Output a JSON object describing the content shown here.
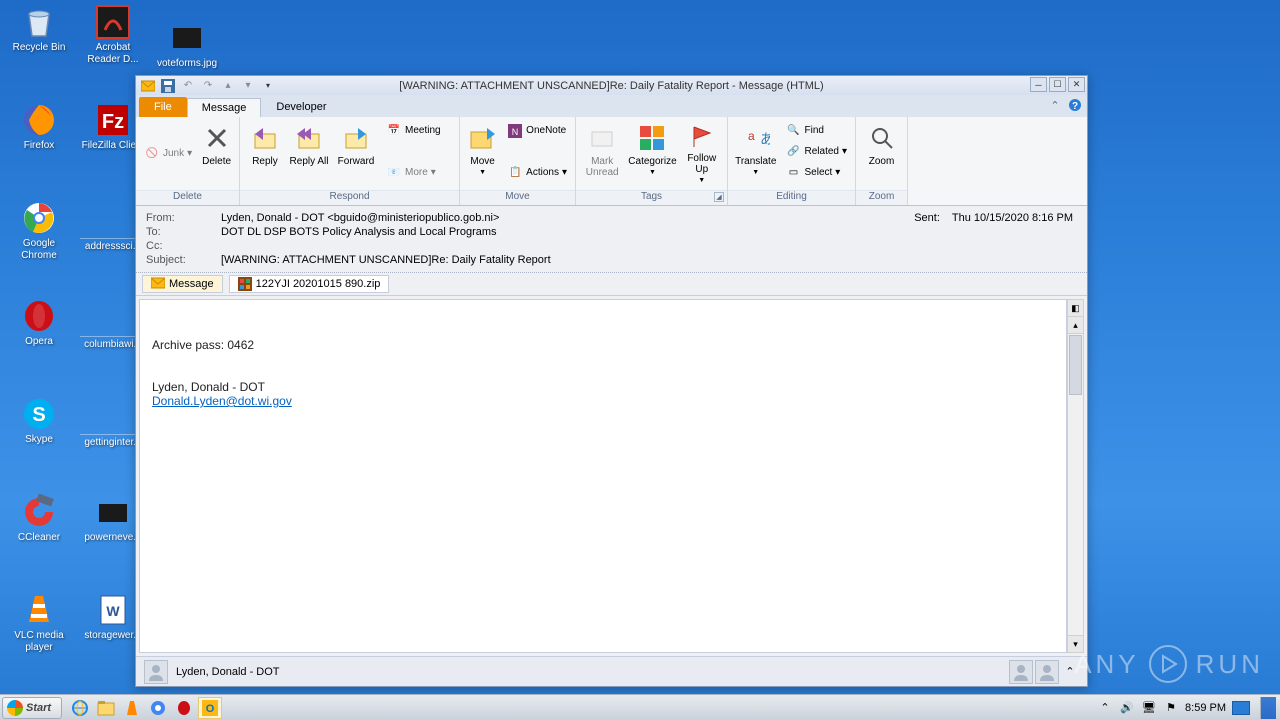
{
  "desktop": {
    "icons": [
      {
        "label": "Recycle Bin"
      },
      {
        "label": "Acrobat Reader D..."
      },
      {
        "label": "voteforms.jpg"
      },
      {
        "label": "Firefox"
      },
      {
        "label": "FileZilla Clie..."
      },
      {
        "label": "Google Chrome"
      },
      {
        "label": "addresssci..."
      },
      {
        "label": "Opera"
      },
      {
        "label": "columbiawi..."
      },
      {
        "label": "Skype"
      },
      {
        "label": "gettinginter..."
      },
      {
        "label": "CCleaner"
      },
      {
        "label": "powerneve..."
      },
      {
        "label": "VLC media player"
      },
      {
        "label": "storagewer..."
      }
    ]
  },
  "window": {
    "title": "[WARNING: ATTACHMENT UNSCANNED]Re: Daily Fatality Report  -  Message (HTML)"
  },
  "tabs": {
    "file": "File",
    "message": "Message",
    "developer": "Developer"
  },
  "ribbon": {
    "junk": "Junk",
    "delete": "Delete",
    "delete_group": "Delete",
    "reply": "Reply",
    "reply_all": "Reply All",
    "forward": "Forward",
    "meeting": "Meeting",
    "more": "More",
    "respond_group": "Respond",
    "move": "Move",
    "onenote": "OneNote",
    "actions": "Actions",
    "move_group": "Move",
    "mark_unread": "Mark Unread",
    "categorize": "Categorize",
    "follow_up": "Follow Up",
    "tags_group": "Tags",
    "translate": "Translate",
    "find": "Find",
    "related": "Related",
    "select": "Select",
    "editing_group": "Editing",
    "zoom": "Zoom",
    "zoom_group": "Zoom"
  },
  "header": {
    "from_label": "From:",
    "from_value": "Lyden, Donald - DOT <bguido@ministeriopublico.gob.ni>",
    "to_label": "To:",
    "to_value": "DOT DL DSP BOTS Policy Analysis and Local Programs",
    "cc_label": "Cc:",
    "cc_value": "",
    "subject_label": "Subject:",
    "subject_value": "[WARNING: ATTACHMENT UNSCANNED]Re: Daily Fatality Report",
    "sent_label": "Sent:",
    "sent_value": "Thu 10/15/2020 8:16 PM"
  },
  "attachments": {
    "message_tab": "Message",
    "file_name": "122YJI 20201015 890.zip"
  },
  "body": {
    "line1": "Archive pass: 0462",
    "signature_name": "Lyden, Donald - DOT",
    "signature_email": "Donald.Lyden@dot.wi.gov"
  },
  "footer": {
    "contact": "Lyden, Donald - DOT"
  },
  "taskbar": {
    "start": "Start",
    "clock": "8:59 PM"
  },
  "watermark": {
    "text1": "ANY",
    "text2": "RUN"
  }
}
